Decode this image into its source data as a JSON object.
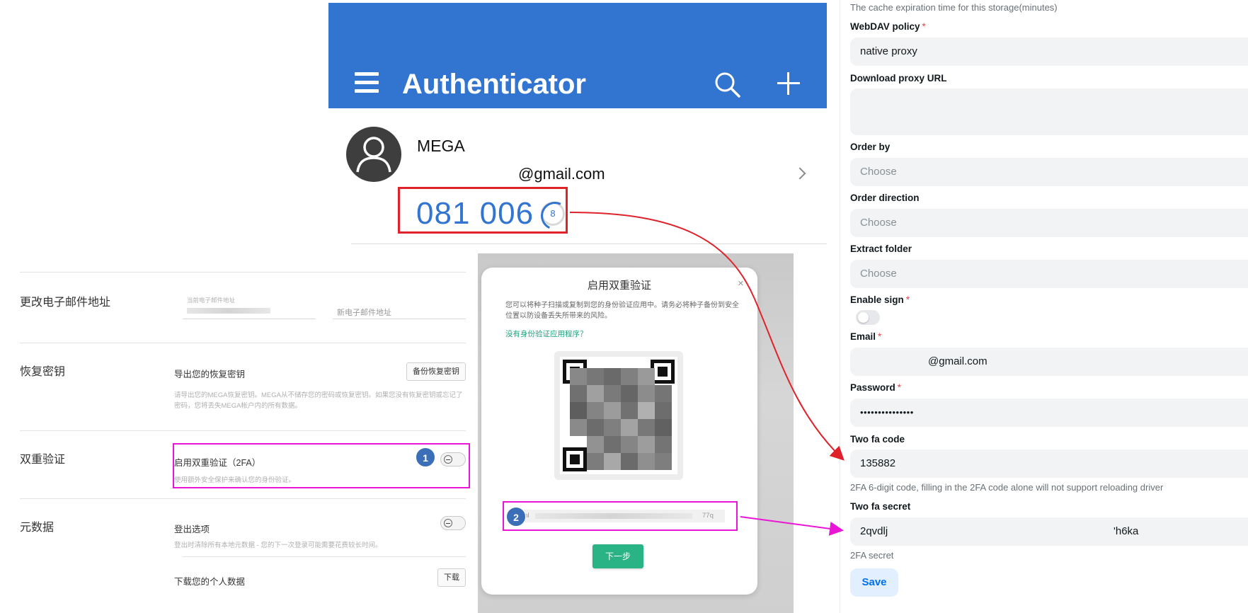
{
  "authenticator": {
    "title": "Authenticator",
    "account_name": "MEGA",
    "account_email": "@gmail.com",
    "otp_code": "081 006",
    "otp_seconds_left": "8"
  },
  "mega_settings": {
    "rows": [
      {
        "title": "更改电子邮件地址",
        "current_email_label": "当前电子邮件地址",
        "new_email_placeholder": "新电子邮件地址"
      },
      {
        "title": "恢复密钥",
        "label": "导出您的恢复密钥",
        "button": "备份恢复密钥",
        "description": "请导出您的MEGA恢复密钥。MEGA从不储存您的密码或恢复密钥。如果您没有恢复密钥或忘记了密码，您将丢失MEGA帐户内的所有数据。"
      },
      {
        "title": "双重验证",
        "label": "启用双重验证（2FA）",
        "description": "使用额外安全保护来确认您的身份验证。",
        "badge": "1"
      },
      {
        "title": "元数据",
        "label": "登出选项",
        "description": "登出时清除所有本地元数据 - 您的下一次登录可能需要花费较长时间。",
        "download_label": "下载您的个人数据",
        "download_button": "下载"
      }
    ]
  },
  "dialog": {
    "title": "启用双重验证",
    "close": "×",
    "description": "您可以将种子扫描或复制到您的身份验证应用中。请务必将种子备份到安全位置以防设备丢失所带来的风险。",
    "link": "没有身份验证应用程序？",
    "secret_start": "jnl",
    "secret_end": "77q",
    "badge": "2",
    "next_button": "下一步"
  },
  "storage_form": {
    "top_help": "The cache expiration time for this storage(minutes)",
    "webdav_policy": {
      "label": "WebDAV policy",
      "value": "native proxy"
    },
    "download_proxy": {
      "label": "Download proxy URL",
      "value": ""
    },
    "order_by": {
      "label": "Order by",
      "placeholder": "Choose"
    },
    "order_direction": {
      "label": "Order direction",
      "placeholder": "Choose"
    },
    "extract_folder": {
      "label": "Extract folder",
      "placeholder": "Choose"
    },
    "enable_sign": {
      "label": "Enable sign"
    },
    "email": {
      "label": "Email",
      "value": "@gmail.com"
    },
    "password": {
      "label": "Password",
      "value": "•••••••••••••••"
    },
    "two_fa_code": {
      "label": "Two fa code",
      "value": "135882",
      "help": "2FA 6-digit code, filling in the 2FA code alone will not support reloading driver"
    },
    "two_fa_secret": {
      "label": "Two fa secret",
      "value_start": "2qvdlj",
      "value_end": "'h6ka",
      "help": "2FA secret"
    },
    "save_button": "Save"
  },
  "colors": {
    "auth_header": "#3275d0",
    "highlight_red": "#e0232b",
    "highlight_magenta": "#ea16d6",
    "dialog_button": "#2ab486",
    "save_button_text": "#0070f3"
  },
  "icons": [
    "menu-icon",
    "search-icon",
    "plus-icon",
    "user-avatar-icon",
    "chevron-right-icon",
    "close-icon",
    "toggle-icon"
  ]
}
